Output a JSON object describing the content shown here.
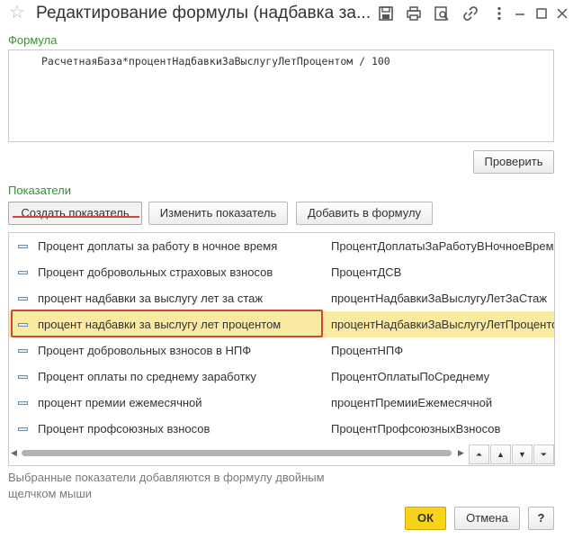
{
  "window": {
    "title": "Редактирование формулы (надбавка за...",
    "toolbar_icons": [
      "save-icon",
      "print-icon",
      "preview-icon",
      "link-icon",
      "more-icon",
      "minimize-icon",
      "maximize-icon",
      "close-icon"
    ]
  },
  "formula": {
    "label": "Формула",
    "text": "РасчетнаяБаза*процентНадбавкиЗаВыслугуЛетПроцентом / 100",
    "check_button": "Проверить"
  },
  "indicators": {
    "label": "Показатели",
    "buttons": {
      "create": "Создать показатель",
      "edit": "Изменить показатель",
      "add": "Добавить в формулу"
    },
    "rows": [
      {
        "name": "Процент доплаты за работу в ночное время",
        "id": "ПроцентДоплатыЗаРаботуВНочноеВремя",
        "selected": false
      },
      {
        "name": "Процент добровольных страховых взносов",
        "id": "ПроцентДСВ",
        "selected": false
      },
      {
        "name": "процент надбавки за выслугу лет за стаж",
        "id": "процентНадбавкиЗаВыслугуЛетЗаСтаж",
        "selected": false
      },
      {
        "name": "процент надбавки за выслугу лет процентом",
        "id": "процентНадбавкиЗаВыслугуЛетПроцентом",
        "selected": true
      },
      {
        "name": "Процент добровольных взносов в НПФ",
        "id": "ПроцентНПФ",
        "selected": false
      },
      {
        "name": "Процент оплаты по среднему заработку",
        "id": "ПроцентОплатыПоСреднему",
        "selected": false
      },
      {
        "name": "процент премии ежемесячной",
        "id": "процентПремииЕжемесячной",
        "selected": false
      },
      {
        "name": "Процент профсоюзных взносов",
        "id": "ПроцентПрофсоюзныхВзносов",
        "selected": false
      }
    ]
  },
  "hint": "Выбранные показатели добавляются в формулу двойным щелчком мыши",
  "footer": {
    "ok": "ОК",
    "cancel": "Отмена",
    "help": "?"
  },
  "colors": {
    "accent_green": "#3b8f3b",
    "selected_row": "#fbeaa2",
    "highlight_red": "#d0453c",
    "ok_yellow": "#f7d31c"
  }
}
